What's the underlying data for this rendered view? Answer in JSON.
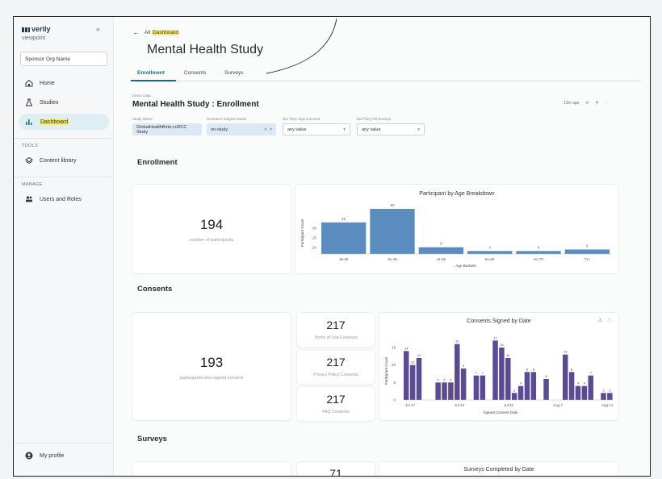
{
  "sidebar": {
    "logo_text": "verily",
    "logo_sub": "viewpoint",
    "collapse_glyph": "«",
    "org_name": "Sponsor Org Name",
    "nav": [
      {
        "label": "Home",
        "icon": "home-icon"
      },
      {
        "label": "Studies",
        "icon": "studies-icon"
      },
      {
        "label": "Dashboard",
        "icon": "chart-icon",
        "active": true
      }
    ],
    "tools_label": "TOOLS",
    "tools": [
      {
        "label": "Content library",
        "icon": "library-icon"
      }
    ],
    "manage_label": "MANAGE",
    "manage": [
      {
        "label": "Users and Roles",
        "icon": "users-icon"
      }
    ],
    "profile_label": "My profile"
  },
  "header": {
    "back_prefix": "All",
    "back_highlight": "Dashboard",
    "title": "Mental Health Study",
    "tabs": [
      "Enrollment",
      "Consents",
      "Surveys"
    ]
  },
  "page": {
    "caption": "Demo Data",
    "subtitle": "Mental Health Study : Enrollment",
    "toolbar_time": "13m ago"
  },
  "filters": [
    {
      "label": "Study Name",
      "value": "GlobalHealthBmb-ccRCC Study",
      "style": "chip"
    },
    {
      "label": "Research Subject Status",
      "value": "on-study",
      "style": "chip"
    },
    {
      "label": "Did They Sign Consent",
      "value": "any value",
      "style": "plain"
    },
    {
      "label": "Did They Fill Surveys",
      "value": "any value",
      "style": "plain"
    }
  ],
  "enrollment": {
    "heading": "Enrollment",
    "count": "194",
    "count_caption": "number of participants"
  },
  "consents": {
    "heading": "Consents",
    "count": "193",
    "count_caption": "participants who signed consent",
    "stats": [
      {
        "value": "217",
        "caption": "Terms of Use Consents"
      },
      {
        "value": "217",
        "caption": "Privacy Policy Consents"
      },
      {
        "value": "217",
        "caption": "FAQ Consents"
      }
    ]
  },
  "surveys": {
    "heading": "Surveys",
    "partial_value": "71",
    "chart_title": "Surveys Completed by Date"
  },
  "colors": {
    "accent": "#1c6b7c",
    "age_bar": "#5b8cc0",
    "consent_bar": "#5b4a94",
    "highlight": "#f7e96a"
  },
  "chart_data": [
    {
      "type": "bar",
      "title": "Participant by Age Breakdown",
      "xlabel": "Age Buckets",
      "ylabel": "Participant Count",
      "categories": [
        "18-30",
        "31-40",
        "41-50",
        "51-60",
        "61-70",
        "71+"
      ],
      "values": [
        42,
        60,
        9,
        4,
        4,
        6
      ],
      "ylim": [
        0,
        60
      ],
      "yticks": [
        20,
        25,
        30
      ]
    },
    {
      "type": "bar",
      "title": "Consents Signed by Date",
      "xlabel": "Signed Consent Date",
      "ylabel": "Participant Count",
      "x_tick_labels": [
        "Jul 17",
        "Jul 24",
        "Jul 31",
        "Aug 7",
        "Aug 14"
      ],
      "yticks": [
        0,
        5,
        10,
        15
      ],
      "values": [
        14,
        10,
        12,
        0,
        0,
        5,
        5,
        5,
        16,
        9,
        0,
        7,
        7,
        0,
        17,
        15,
        12,
        2,
        4,
        8,
        8,
        0,
        6,
        0,
        0,
        13,
        8,
        4,
        4,
        7,
        0,
        2,
        2
      ],
      "data_labels": [
        "14",
        "10",
        "12",
        "",
        "",
        "5",
        "5",
        "5",
        "16",
        "9",
        "",
        "7",
        "7",
        "",
        "17",
        "15",
        "12",
        "2",
        "4",
        "8",
        "8",
        "",
        "6",
        "",
        "",
        "13",
        "8",
        "4",
        "4",
        "7",
        "",
        "2",
        "2"
      ],
      "ylim": [
        0,
        18
      ]
    }
  ]
}
